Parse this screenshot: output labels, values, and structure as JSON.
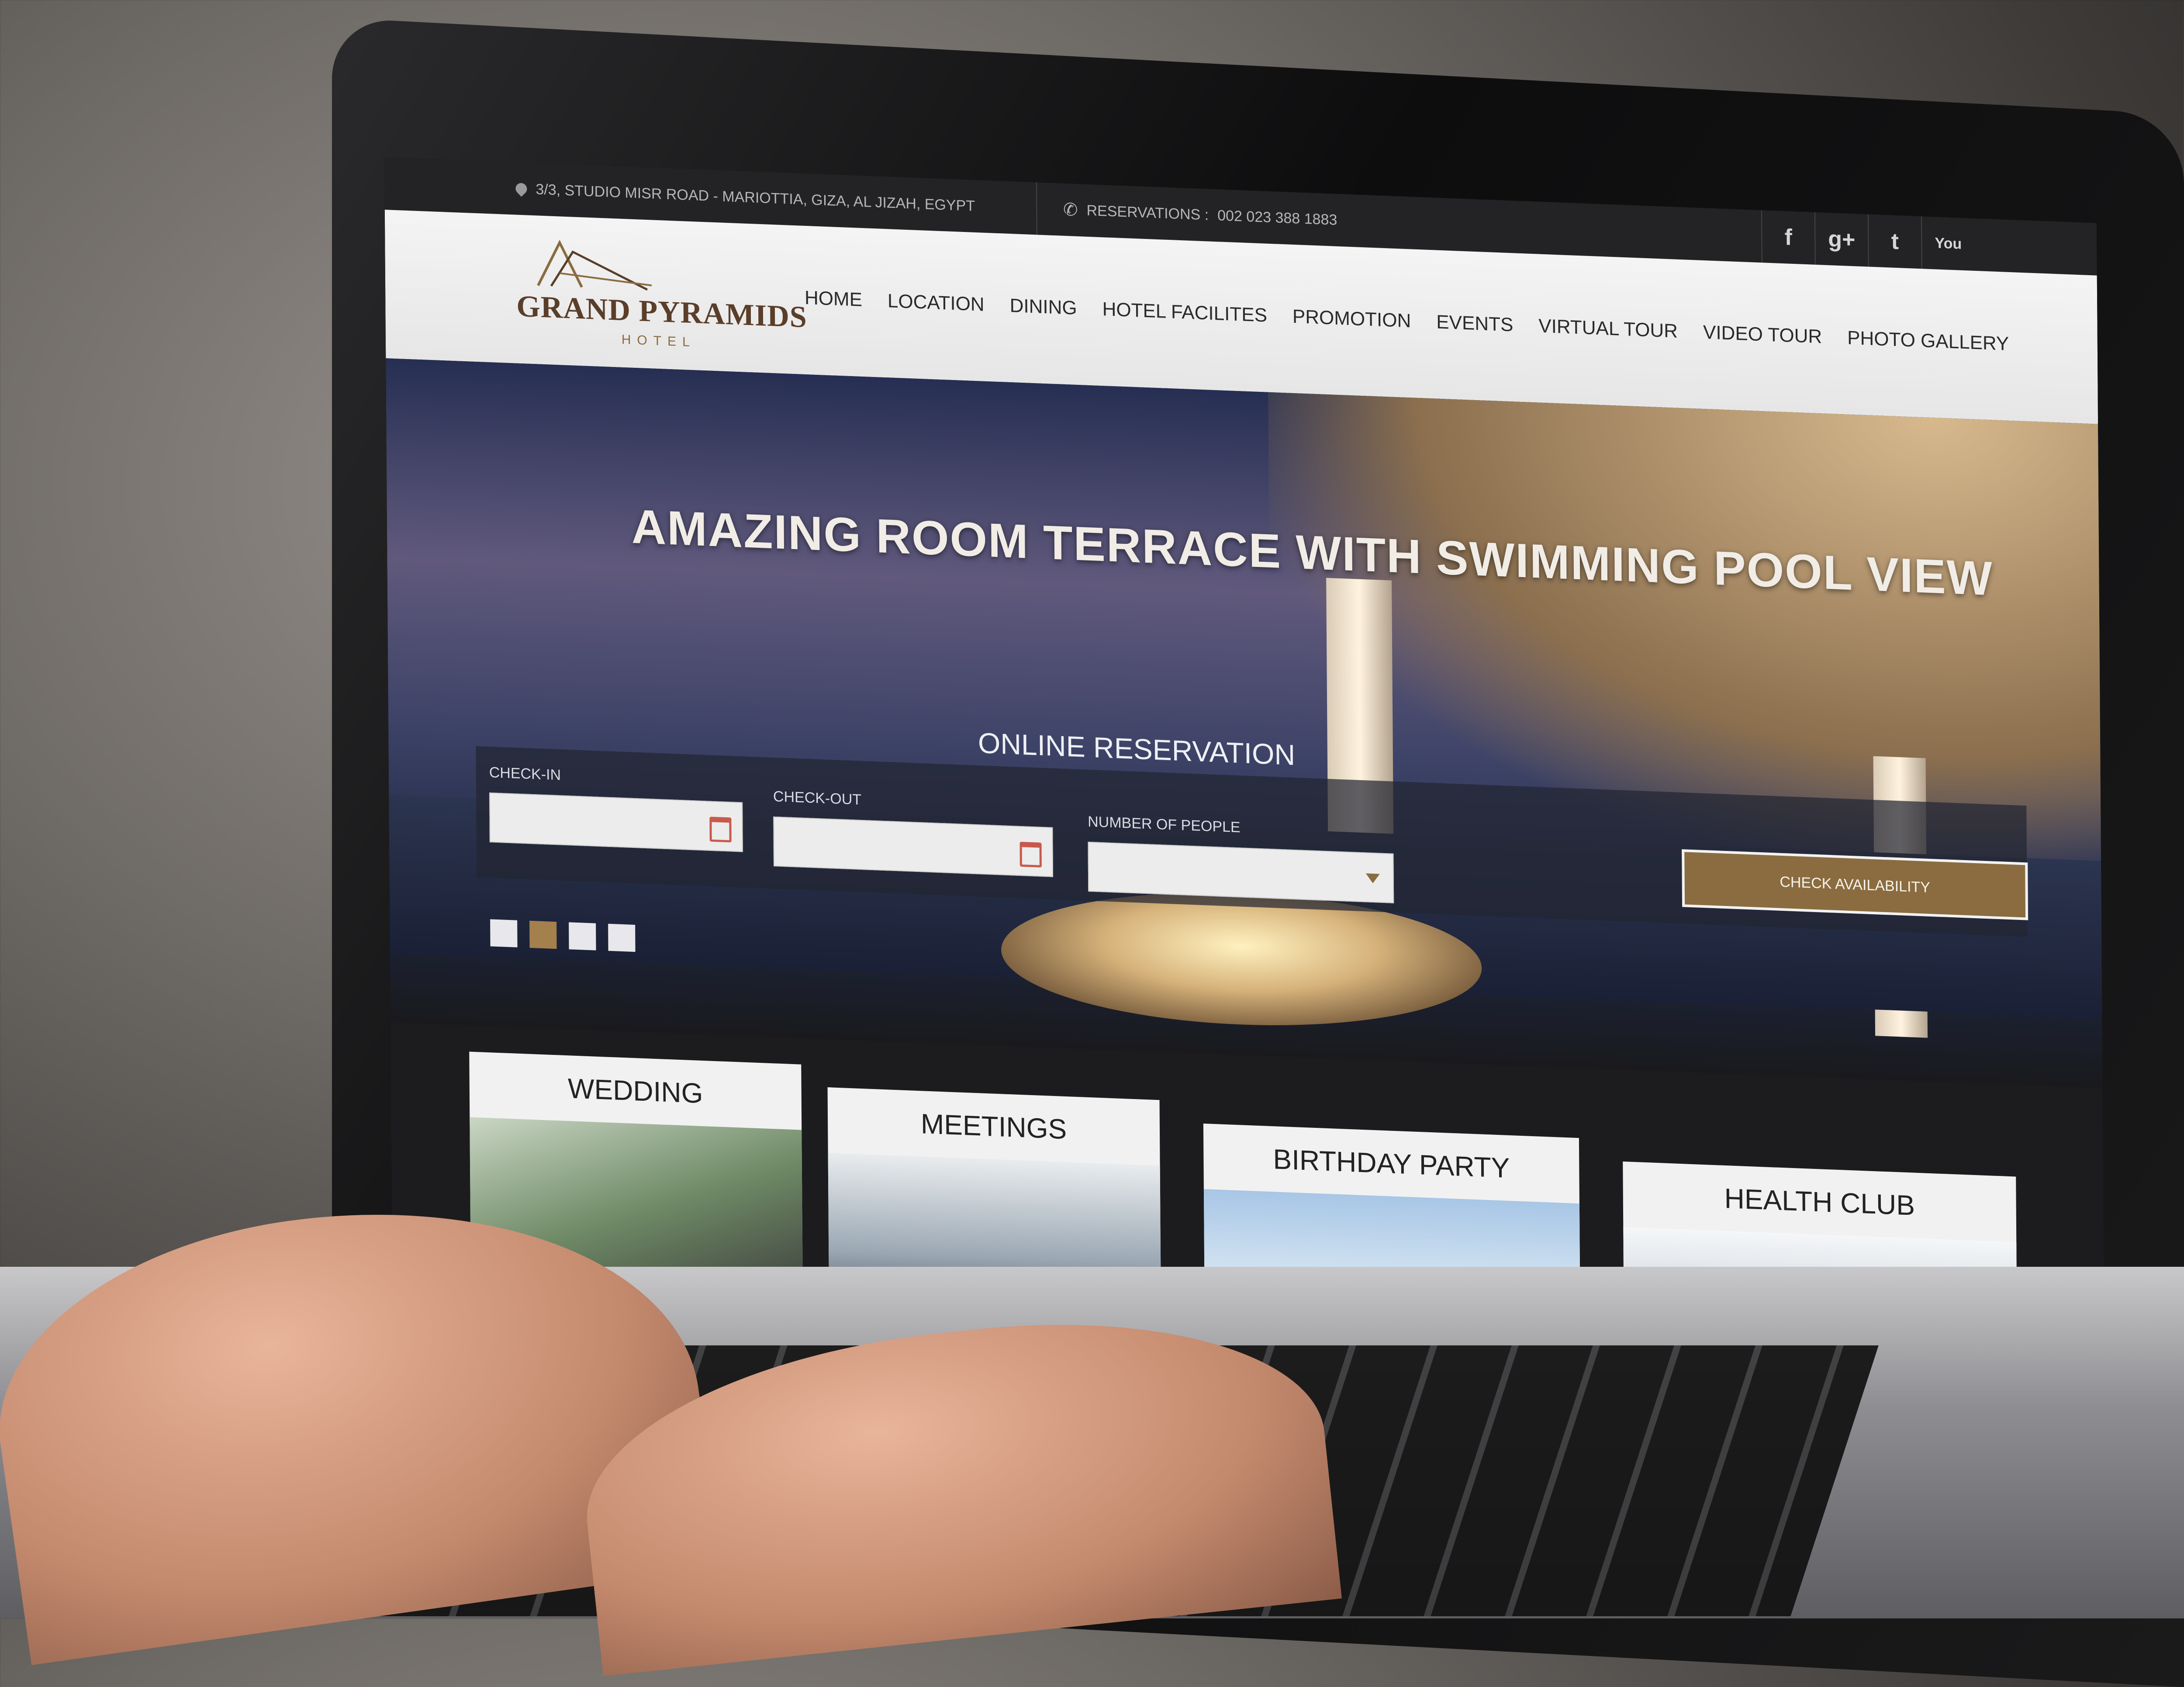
{
  "topbar": {
    "address": "3/3, STUDIO MISR ROAD - MARIOTTIA, GIZA, AL JIZAH, EGYPT",
    "phone_label": "RESERVATIONS :",
    "phone_number": "002 023 388 1883",
    "social": [
      {
        "icon": "facebook-icon",
        "glyph": "f"
      },
      {
        "icon": "google-plus-icon",
        "glyph": "g+"
      },
      {
        "icon": "twitter-icon",
        "glyph": "t"
      },
      {
        "icon": "youtube-icon",
        "glyph": "You"
      }
    ]
  },
  "logo": {
    "name": "GRAND PYRAMIDS",
    "subtitle": "HOTEL"
  },
  "nav": [
    "HOME",
    "LOCATION",
    "DINING",
    "HOTEL FACILITES",
    "PROMOTION",
    "EVENTS",
    "VIRTUAL TOUR",
    "VIDEO TOUR",
    "PHOTO GALLERY"
  ],
  "hero": {
    "headline": "AMAZING ROOM TERRACE WITH SWIMMING POOL VIEW",
    "reservation_title": "ONLINE RESERVATION",
    "fields": {
      "checkin_label": "CHECK-IN",
      "checkout_label": "CHECK-OUT",
      "people_label": "NUMBER OF PEOPLE"
    },
    "button": "CHECK AVAILABILITY",
    "slides": 4,
    "active_slide": 2
  },
  "cards": [
    "WEDDING",
    "MEETINGS",
    "BIRTHDAY PARTY",
    "HEALTH CLUB"
  ],
  "colors": {
    "accent": "#8a6c40",
    "topbar": "#232325",
    "header": "#f0f0f0"
  }
}
